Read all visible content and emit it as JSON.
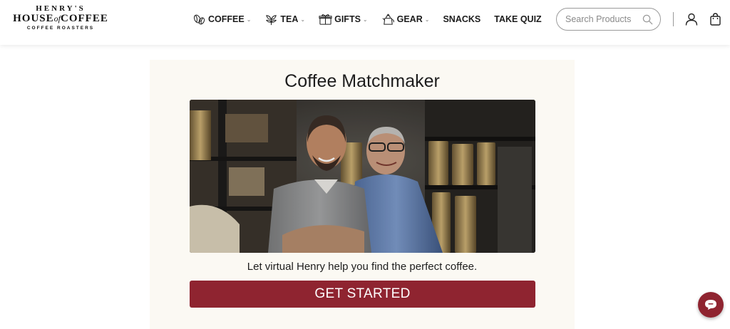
{
  "brand": {
    "line1": "HENRY'S",
    "line2_left": "HOUSE",
    "line2_mid": "of",
    "line2_right": "COFFEE",
    "line3": "COFFEE ROASTERS"
  },
  "nav": [
    {
      "label": "COFFEE",
      "icon": "coffee-beans-icon",
      "has_dropdown": true
    },
    {
      "label": "TEA",
      "icon": "tea-leaf-icon",
      "has_dropdown": true
    },
    {
      "label": "GIFTS",
      "icon": "gift-box-icon",
      "has_dropdown": true
    },
    {
      "label": "GEAR",
      "icon": "kettle-icon",
      "has_dropdown": true
    },
    {
      "label": "SNACKS",
      "has_dropdown": false
    },
    {
      "label": "TAKE QUIZ",
      "has_dropdown": false
    }
  ],
  "search": {
    "placeholder": "Search Products"
  },
  "main": {
    "title": "Coffee Matchmaker",
    "photo_description": "Two smiling men standing in a coffee roastery in front of shelves of metal coffee tins",
    "tagline": "Let virtual Henry help you find the perfect coffee.",
    "cta_label": "GET STARTED"
  },
  "colors": {
    "accent": "#8f2430",
    "card_bg": "#fbf9f3"
  }
}
